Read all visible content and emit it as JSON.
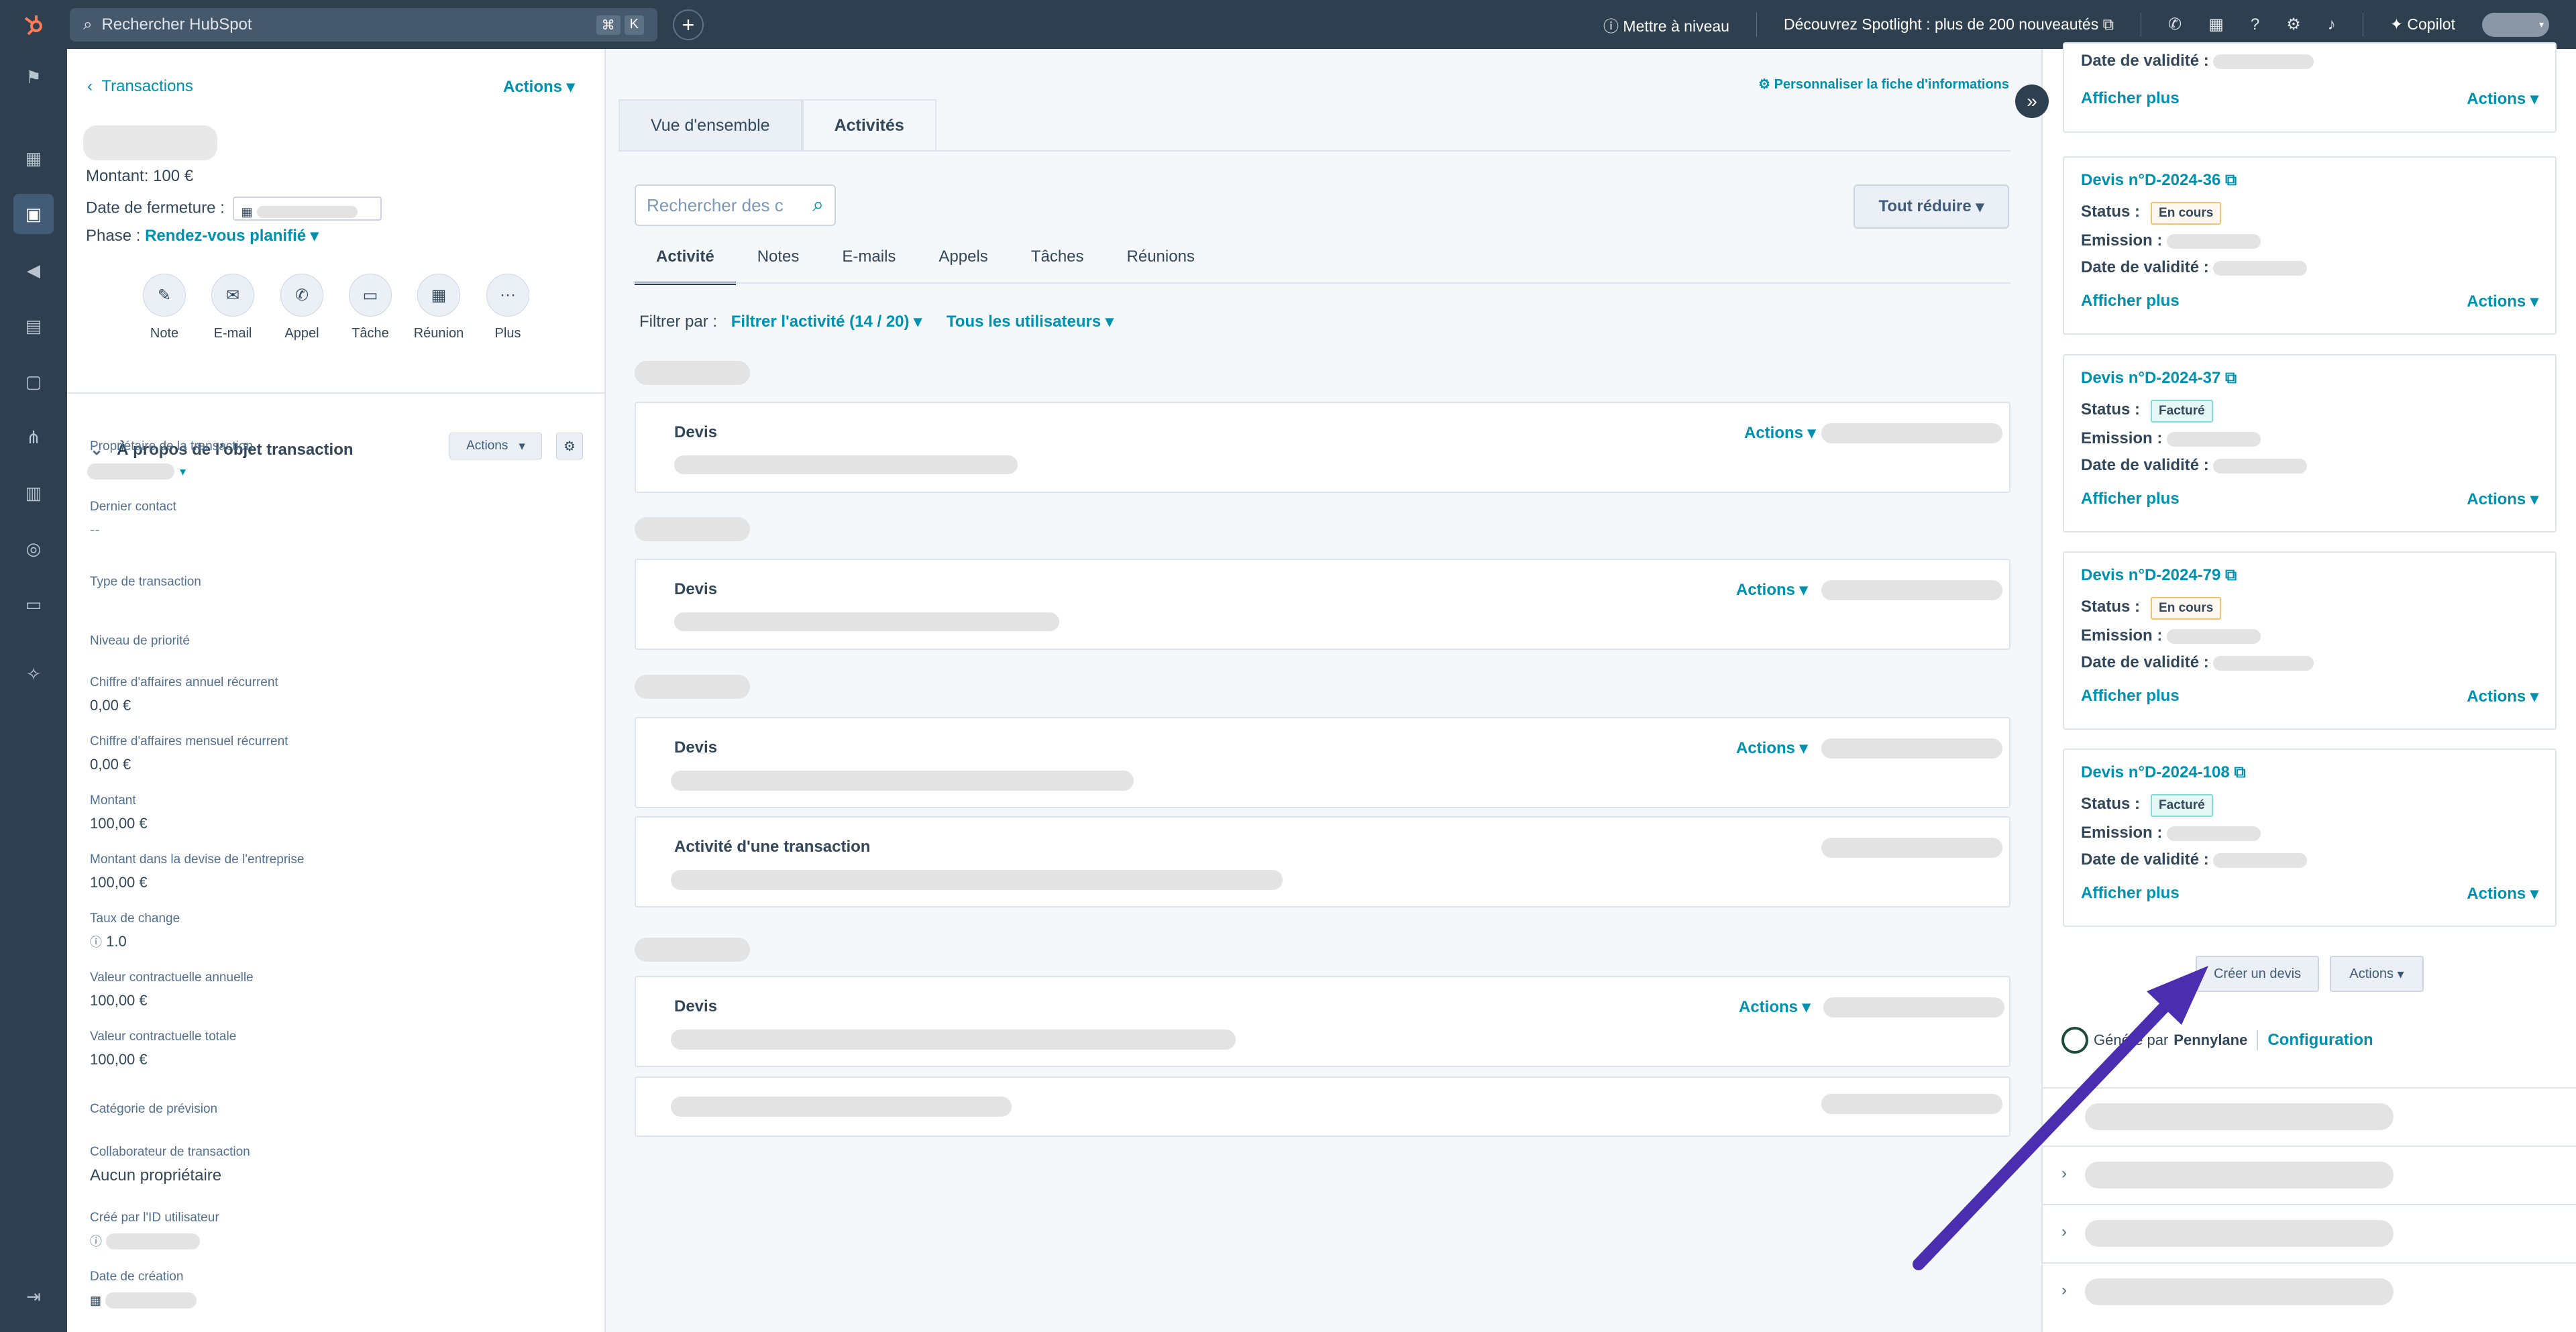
{
  "topbar": {
    "search_placeholder": "Rechercher HubSpot",
    "shortcut_keys": [
      "⌘",
      "K"
    ],
    "upgrade": "Mettre à niveau",
    "spotlight": "Découvrez Spotlight : plus de 200 nouveautés",
    "copilot": "Copilot"
  },
  "left": {
    "back": "Transactions",
    "actions": "Actions",
    "montant": "Montant: 100 €",
    "date_label": "Date de fermeture :",
    "phase_label": "Phase :",
    "phase_value": "Rendez-vous planifié",
    "quick_actions": [
      "Note",
      "E-mail",
      "Appel",
      "Tâche",
      "Réunion",
      "Plus"
    ],
    "section_title": "À propos de l'objet transaction",
    "section_actions": "Actions",
    "props": [
      {
        "label": "Propriétaire de la transaction",
        "value": ""
      },
      {
        "label": "Dernier contact",
        "value": "--"
      },
      {
        "label": "Type de transaction",
        "value": ""
      },
      {
        "label": "Niveau de priorité",
        "value": ""
      },
      {
        "label": "Chiffre d'affaires annuel récurrent",
        "value": "0,00 €"
      },
      {
        "label": "Chiffre d'affaires mensuel récurrent",
        "value": "0,00 €"
      },
      {
        "label": "Montant",
        "value": "100,00 €"
      },
      {
        "label": "Montant dans la devise de l'entreprise",
        "value": "100,00 €"
      },
      {
        "label": "Taux de change",
        "value": "1.0"
      },
      {
        "label": "Valeur contractuelle annuelle",
        "value": "100,00 €"
      },
      {
        "label": "Valeur contractuelle totale",
        "value": "100,00 €"
      },
      {
        "label": "Catégorie de prévision",
        "value": ""
      },
      {
        "label": "Collaborateur de transaction",
        "value": "Aucun propriétaire"
      },
      {
        "label": "Créé par l'ID utilisateur",
        "value": ""
      },
      {
        "label": "Date de création",
        "value": ""
      }
    ]
  },
  "middle": {
    "tabs": [
      "Vue d'ensemble",
      "Activités"
    ],
    "personalize": "Personnaliser la fiche d'informations",
    "search_placeholder": "Rechercher des c",
    "collapse_all": "Tout réduire",
    "sub_tabs": [
      "Activité",
      "Notes",
      "E-mails",
      "Appels",
      "Tâches",
      "Réunions"
    ],
    "filter_label": "Filtrer par :",
    "filter_activity": "Filtrer l'activité (14 / 20)",
    "filter_users": "Tous les utilisateurs",
    "cards": [
      {
        "title": "Devis",
        "actions": "Actions"
      },
      {
        "title": "Devis",
        "actions": "Actions"
      },
      {
        "title": "Devis",
        "actions": "Actions"
      },
      {
        "title": "Activité d'une transaction",
        "actions": ""
      },
      {
        "title": "Devis",
        "actions": "Actions"
      },
      {
        "title": "",
        "actions": ""
      }
    ]
  },
  "right": {
    "top_validity_label": "Date de validité :",
    "show_more": "Afficher plus",
    "actions": "Actions",
    "status_label": "Status :",
    "emission_label": "Emission :",
    "validity_label": "Date de validité :",
    "quotes": [
      {
        "title": "Devis n°D-2024-36",
        "status": "En cours"
      },
      {
        "title": "Devis n°D-2024-37",
        "status": "Facturé"
      },
      {
        "title": "Devis n°D-2024-79",
        "status": "En cours"
      },
      {
        "title": "Devis n°D-2024-108",
        "status": "Facturé"
      }
    ],
    "create_quote": "Créer un devis",
    "footer_generated": "Généré par",
    "footer_brand": "Pennylane",
    "footer_config": "Configuration"
  },
  "colors": {
    "nav": "#2e3f50",
    "link": "#0091ae",
    "arrow": "#4b2db0"
  }
}
